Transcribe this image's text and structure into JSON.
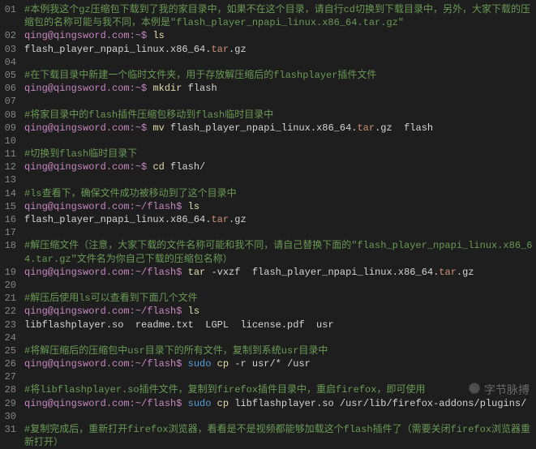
{
  "watermark": "字节脉搏",
  "lines": [
    {
      "n": "01",
      "segs": [
        {
          "c": "cmt",
          "t": "#本例我这个gz压缩包下载到了我的家目录中，如果不在这个目录，请自行cd切换到下载目录中，另外，大家下载的压缩包的名称可能与我不同，本例是\"flash_player_npapi_linux.x86_64.tar.gz\""
        }
      ]
    },
    {
      "n": "02",
      "segs": [
        {
          "c": "prm",
          "t": "qing@qingsword.com:~$ "
        },
        {
          "c": "cmd",
          "t": "ls"
        }
      ]
    },
    {
      "n": "03",
      "segs": [
        {
          "c": "pln",
          "t": "flash_player_npapi_linux.x86_64."
        },
        {
          "c": "ext",
          "t": "tar"
        },
        {
          "c": "pln",
          "t": ".gz"
        }
      ]
    },
    {
      "n": "04",
      "segs": [
        {
          "c": "pln",
          "t": ""
        }
      ]
    },
    {
      "n": "05",
      "segs": [
        {
          "c": "cmt",
          "t": "#在下载目录中新建一个临时文件夹，用于存放解压缩后的flashplayer插件文件"
        }
      ]
    },
    {
      "n": "06",
      "segs": [
        {
          "c": "prm",
          "t": "qing@qingsword.com:~$ "
        },
        {
          "c": "cmd",
          "t": "mkdir"
        },
        {
          "c": "pln",
          "t": " flash"
        }
      ]
    },
    {
      "n": "07",
      "segs": [
        {
          "c": "pln",
          "t": ""
        }
      ]
    },
    {
      "n": "08",
      "segs": [
        {
          "c": "cmt",
          "t": "#将家目录中的flash插件压缩包移动到flash临时目录中"
        }
      ]
    },
    {
      "n": "09",
      "segs": [
        {
          "c": "prm",
          "t": "qing@qingsword.com:~$ "
        },
        {
          "c": "cmd",
          "t": "mv"
        },
        {
          "c": "pln",
          "t": " flash_player_npapi_linux.x86_64."
        },
        {
          "c": "ext",
          "t": "tar"
        },
        {
          "c": "pln",
          "t": ".gz  flash"
        }
      ]
    },
    {
      "n": "10",
      "segs": [
        {
          "c": "pln",
          "t": ""
        }
      ]
    },
    {
      "n": "11",
      "segs": [
        {
          "c": "cmt",
          "t": "#切换到flash临时目录下"
        }
      ]
    },
    {
      "n": "12",
      "segs": [
        {
          "c": "prm",
          "t": "qing@qingsword.com:~$ "
        },
        {
          "c": "cmd",
          "t": "cd"
        },
        {
          "c": "pln",
          "t": " flash/"
        }
      ]
    },
    {
      "n": "13",
      "segs": [
        {
          "c": "pln",
          "t": ""
        }
      ]
    },
    {
      "n": "14",
      "segs": [
        {
          "c": "cmt",
          "t": "#ls查看下，确保文件成功被移动到了这个目录中"
        }
      ]
    },
    {
      "n": "15",
      "segs": [
        {
          "c": "prm",
          "t": "qing@qingsword.com:~/flash$ "
        },
        {
          "c": "cmd",
          "t": "ls"
        }
      ]
    },
    {
      "n": "16",
      "segs": [
        {
          "c": "pln",
          "t": "flash_player_npapi_linux.x86_64."
        },
        {
          "c": "ext",
          "t": "tar"
        },
        {
          "c": "pln",
          "t": ".gz"
        }
      ]
    },
    {
      "n": "17",
      "segs": [
        {
          "c": "pln",
          "t": ""
        }
      ]
    },
    {
      "n": "18",
      "segs": [
        {
          "c": "cmt",
          "t": "#解压缩文件（注意，大家下载的文件名称可能和我不同，请自己替换下面的\"flash_player_npapi_linux.x86_64.tar.gz\"文件名为你自己下载的压缩包名称）"
        }
      ]
    },
    {
      "n": "19",
      "segs": [
        {
          "c": "prm",
          "t": "qing@qingsword.com:~/flash$ "
        },
        {
          "c": "cmd",
          "t": "tar"
        },
        {
          "c": "pln",
          "t": " -vxzf  flash_player_npapi_linux.x86_64."
        },
        {
          "c": "ext",
          "t": "tar"
        },
        {
          "c": "pln",
          "t": ".gz"
        }
      ]
    },
    {
      "n": "20",
      "segs": [
        {
          "c": "pln",
          "t": ""
        }
      ]
    },
    {
      "n": "21",
      "segs": [
        {
          "c": "cmt",
          "t": "#解压后使用ls可以查看到下面几个文件"
        }
      ]
    },
    {
      "n": "22",
      "segs": [
        {
          "c": "prm",
          "t": "qing@qingsword.com:~/flash$ "
        },
        {
          "c": "cmd",
          "t": "ls"
        }
      ]
    },
    {
      "n": "23",
      "segs": [
        {
          "c": "pln",
          "t": "libflashplayer.so  readme.txt  LGPL  license.pdf  usr"
        }
      ]
    },
    {
      "n": "24",
      "segs": [
        {
          "c": "pln",
          "t": ""
        }
      ]
    },
    {
      "n": "25",
      "segs": [
        {
          "c": "cmt",
          "t": "#将解压缩后的压缩包中usr目录下的所有文件，复制到系统usr目录中"
        }
      ]
    },
    {
      "n": "26",
      "segs": [
        {
          "c": "prm",
          "t": "qing@qingsword.com:~/flash$ "
        },
        {
          "c": "sudo",
          "t": "sudo"
        },
        {
          "c": "pln",
          "t": " "
        },
        {
          "c": "cmd",
          "t": "cp"
        },
        {
          "c": "pln",
          "t": " -r usr/* /usr"
        }
      ]
    },
    {
      "n": "27",
      "segs": [
        {
          "c": "pln",
          "t": ""
        }
      ]
    },
    {
      "n": "28",
      "segs": [
        {
          "c": "cmt",
          "t": "#将libflashplayer.so插件文件，复制到firefox插件目录中，重启firefox，即可使用"
        }
      ]
    },
    {
      "n": "29",
      "segs": [
        {
          "c": "prm",
          "t": "qing@qingsword.com:~/flash$ "
        },
        {
          "c": "sudo",
          "t": "sudo"
        },
        {
          "c": "pln",
          "t": " "
        },
        {
          "c": "cmd",
          "t": "cp"
        },
        {
          "c": "pln",
          "t": " libflashplayer.so /usr/lib/firefox-addons/plugins/"
        }
      ]
    },
    {
      "n": "30",
      "segs": [
        {
          "c": "pln",
          "t": ""
        }
      ]
    },
    {
      "n": "31",
      "segs": [
        {
          "c": "cmt",
          "t": "#复制完成后，重新打开firefox浏览器，看看是不是视频都能够加载这个flash插件了（需要关闭firefox浏览器重新打开）"
        }
      ]
    }
  ]
}
